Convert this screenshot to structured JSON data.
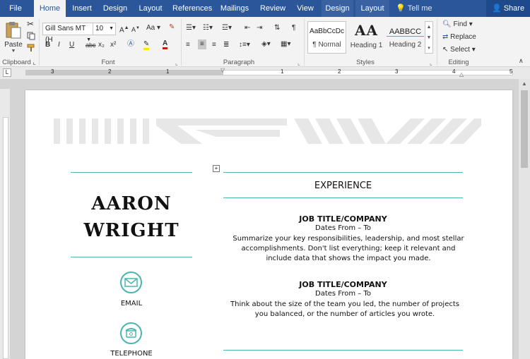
{
  "tabs": [
    {
      "label": "File"
    },
    {
      "label": "Home"
    },
    {
      "label": "Insert"
    },
    {
      "label": "Design"
    },
    {
      "label": "Layout"
    },
    {
      "label": "References"
    },
    {
      "label": "Mailings"
    },
    {
      "label": "Review"
    },
    {
      "label": "View"
    },
    {
      "label": "Design"
    },
    {
      "label": "Layout"
    }
  ],
  "tell_me": "Tell me",
  "share": "Share",
  "clipboard": {
    "paste": "Paste",
    "label": "Clipboard"
  },
  "font": {
    "name": "Gill Sans MT (H",
    "size": "10",
    "bold": "B",
    "italic": "I",
    "underline": "U",
    "strike": "abc",
    "sub": "x₂",
    "sup": "x²",
    "label": "Font"
  },
  "paragraph": {
    "label": "Paragraph"
  },
  "styles": {
    "label": "Styles",
    "items": [
      {
        "preview": "AaBbCcDc",
        "name": "¶ Normal"
      },
      {
        "preview": "AA",
        "name": "Heading 1"
      },
      {
        "preview": "AABBCC",
        "name": "Heading 2"
      }
    ]
  },
  "editing": {
    "find": "Find",
    "replace": "Replace",
    "select": "Select",
    "label": "Editing"
  },
  "ruler": {
    "numbers": [
      "3",
      "2",
      "1",
      "1",
      "2",
      "3",
      "4",
      "5"
    ]
  },
  "document": {
    "name_first": "AARON",
    "name_last": "WRIGHT",
    "contacts": [
      {
        "label": "EMAIL"
      },
      {
        "label": "TELEPHONE"
      }
    ],
    "experience_heading": "EXPERIENCE",
    "jobs": [
      {
        "title": "JOB TITLE/COMPANY",
        "dates": "Dates From – To",
        "desc": "Summarize your key responsibilities, leadership, and most stellar accomplishments. Don't list everything; keep it relevant and include data that shows the impact you made."
      },
      {
        "title": "JOB TITLE/COMPANY",
        "dates": "Dates From – To",
        "desc": "Think about the size of the team you led, the number of projects you balanced, or the number of articles you wrote."
      }
    ]
  },
  "colors": {
    "accent": "#2b579a",
    "teal": "#4cb5ae"
  }
}
